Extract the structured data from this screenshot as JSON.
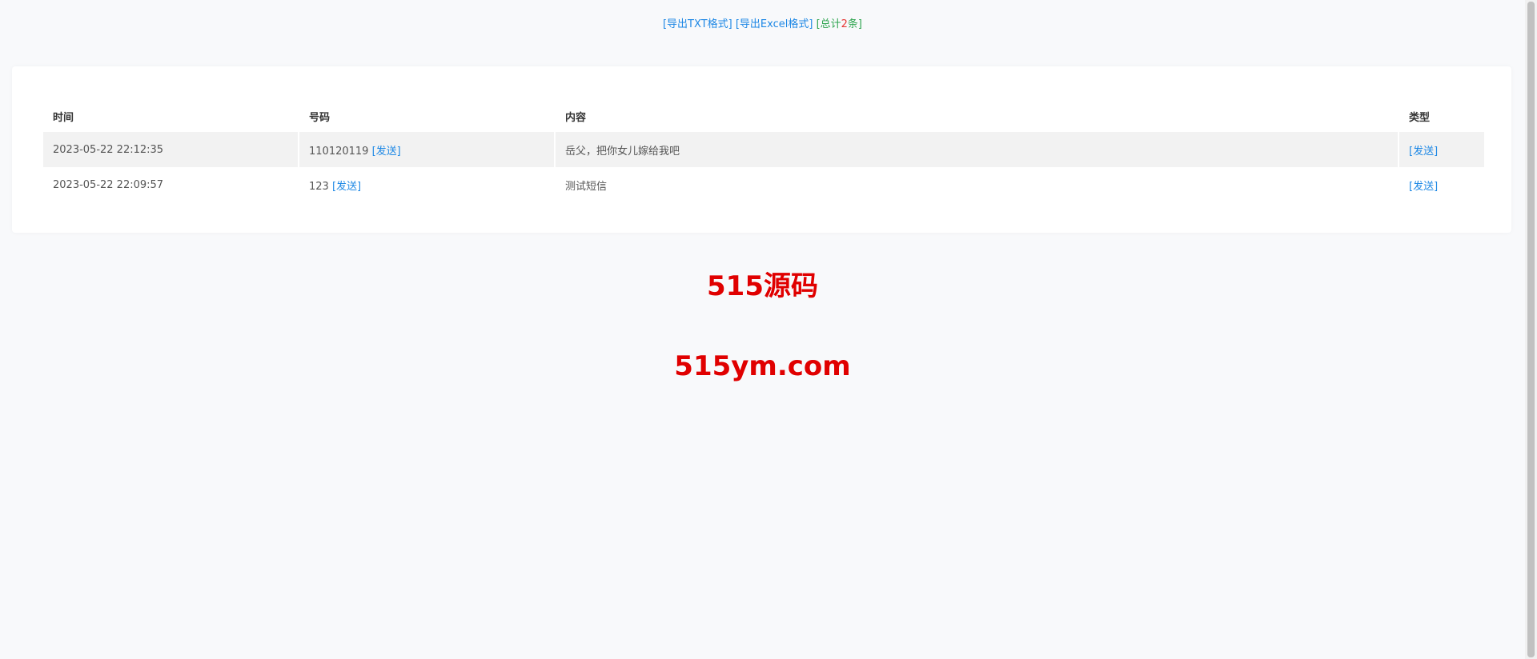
{
  "toolbar": {
    "export_txt": "[导出TXT格式]",
    "export_excel": "[导出Excel格式]",
    "total_prefix": "[总计",
    "total_count": "2",
    "total_suffix": "条]"
  },
  "table": {
    "headers": [
      "时间",
      "号码",
      "内容",
      "类型"
    ],
    "rows": [
      {
        "time": "2023-05-22 22:12:35",
        "number": "110120119",
        "send_link": "[发送]",
        "content": "岳父，把你女儿嫁给我吧",
        "type": "[发送]"
      },
      {
        "time": "2023-05-22 22:09:57",
        "number": "123",
        "send_link": "[发送]",
        "content": "测试短信",
        "type": "[发送]"
      }
    ]
  },
  "watermark": {
    "line1": "515源码",
    "line2": "515ym.com"
  },
  "colors": {
    "link": "#1e88e5",
    "total": "#2ea44f",
    "count": "#e53935",
    "watermark": "#e00000"
  }
}
